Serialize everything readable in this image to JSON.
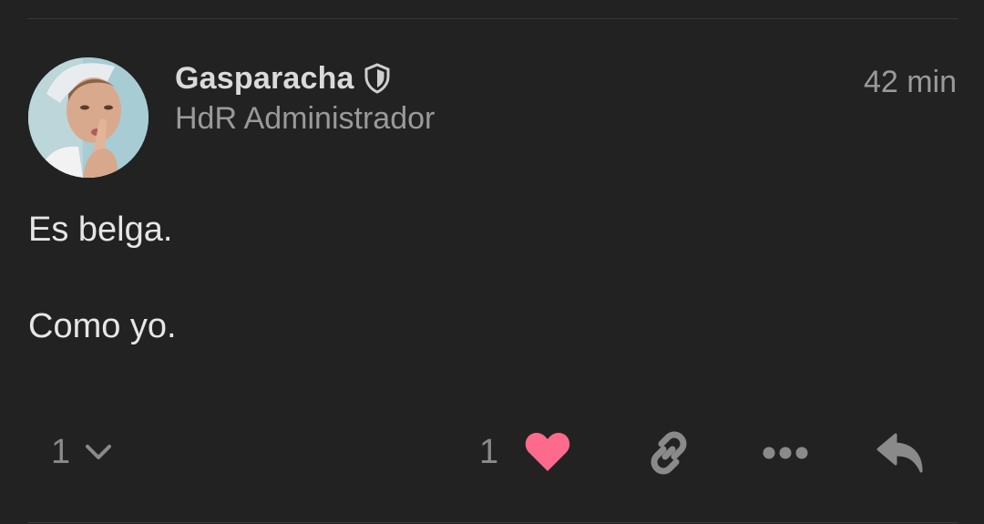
{
  "post": {
    "author": {
      "username": "Gasparacha",
      "title": "HdR Administrador",
      "badge_icon": "shield-icon"
    },
    "timestamp": "42 min",
    "body": [
      "Es belga.",
      "Como yo."
    ]
  },
  "actions": {
    "replies_count": "1",
    "replies_icon": "chevron-down-icon",
    "likes_count": "1",
    "like_icon": "heart-icon",
    "like_color": "#fd6a8b",
    "link_icon": "link-icon",
    "more_icon": "ellipsis-icon",
    "reply_icon": "reply-icon",
    "icon_color": "#8a8a8a"
  },
  "theme": {
    "background": "#222222",
    "divider": "#393939"
  }
}
